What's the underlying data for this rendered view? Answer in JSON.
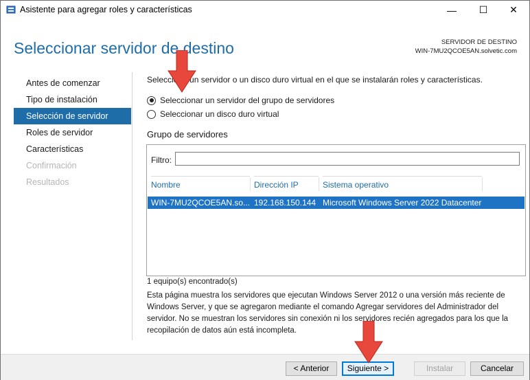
{
  "window": {
    "title": "Asistente para agregar roles y características",
    "minimize_label": "—",
    "maximize_label": "☐",
    "close_label": "✕"
  },
  "header": {
    "page_title": "Seleccionar servidor de destino",
    "dest_label": "SERVIDOR DE DESTINO",
    "dest_value": "WIN-7MU2QCOE5AN.solvetic.com"
  },
  "nav": {
    "items": [
      {
        "label": "Antes de comenzar",
        "state": "normal"
      },
      {
        "label": "Tipo de instalación",
        "state": "normal"
      },
      {
        "label": "Selección de servidor",
        "state": "active"
      },
      {
        "label": "Roles de servidor",
        "state": "normal"
      },
      {
        "label": "Características",
        "state": "normal"
      },
      {
        "label": "Confirmación",
        "state": "disabled"
      },
      {
        "label": "Resultados",
        "state": "disabled"
      }
    ]
  },
  "content": {
    "intro": "Seleccione un servidor o un disco duro virtual en el que se instalarán roles y características.",
    "radio_server_pool": "Seleccionar un servidor del grupo de servidores",
    "radio_vhd": "Seleccionar un disco duro virtual",
    "group_title": "Grupo de servidores",
    "filter_label": "Filtro:",
    "filter_value": "",
    "columns": [
      "Nombre",
      "Dirección IP",
      "Sistema operativo"
    ],
    "rows": [
      {
        "name": "WIN-7MU2QCOE5AN.so...",
        "ip": "192.168.150.144",
        "os": "Microsoft Windows Server 2022 Datacenter"
      }
    ],
    "found_text": "1 equipo(s) encontrado(s)",
    "description": "Esta página muestra los servidores que ejecutan Windows Server 2012 o una versión más reciente de Windows Server, y que se agregaron mediante el comando Agregar servidores del Administrador del servidor. No se muestran los servidores sin conexión ni los servidores recién agregados para los que la recopilación de datos aún está incompleta."
  },
  "footer": {
    "previous": "< Anterior",
    "next": "Siguiente >",
    "install": "Instalar",
    "cancel": "Cancelar"
  },
  "colors": {
    "accent": "#1e6ca8",
    "selection": "#1f73c4",
    "annotation_arrow": "#e8473c"
  }
}
